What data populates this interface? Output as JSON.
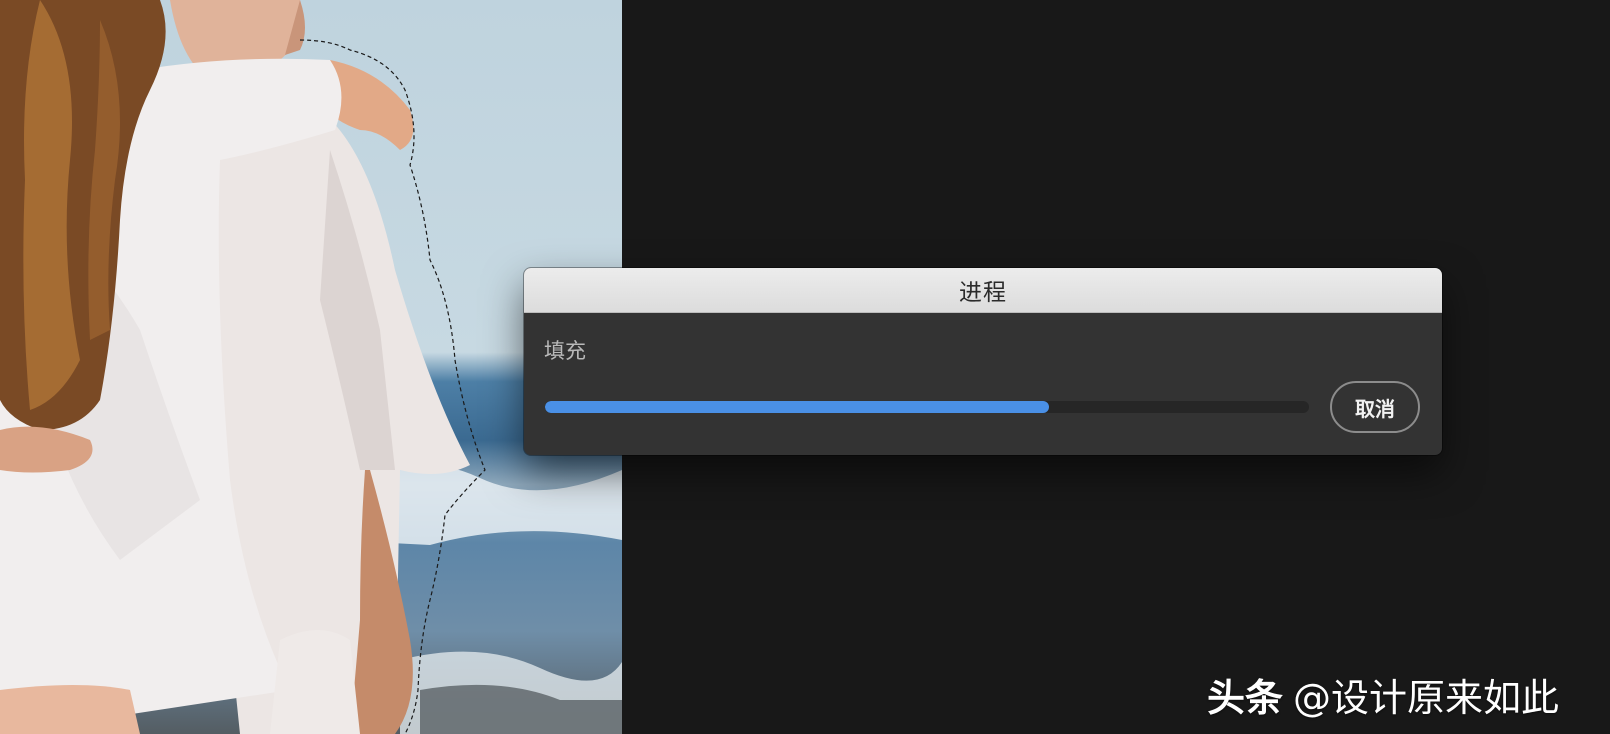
{
  "dialog": {
    "title": "进程",
    "task_label": "填充",
    "progress": 0.66,
    "cancel_label": "取消",
    "accent_color": "#4a90e6"
  },
  "watermark": {
    "brand": "头条",
    "handle": "@设计原来如此"
  }
}
